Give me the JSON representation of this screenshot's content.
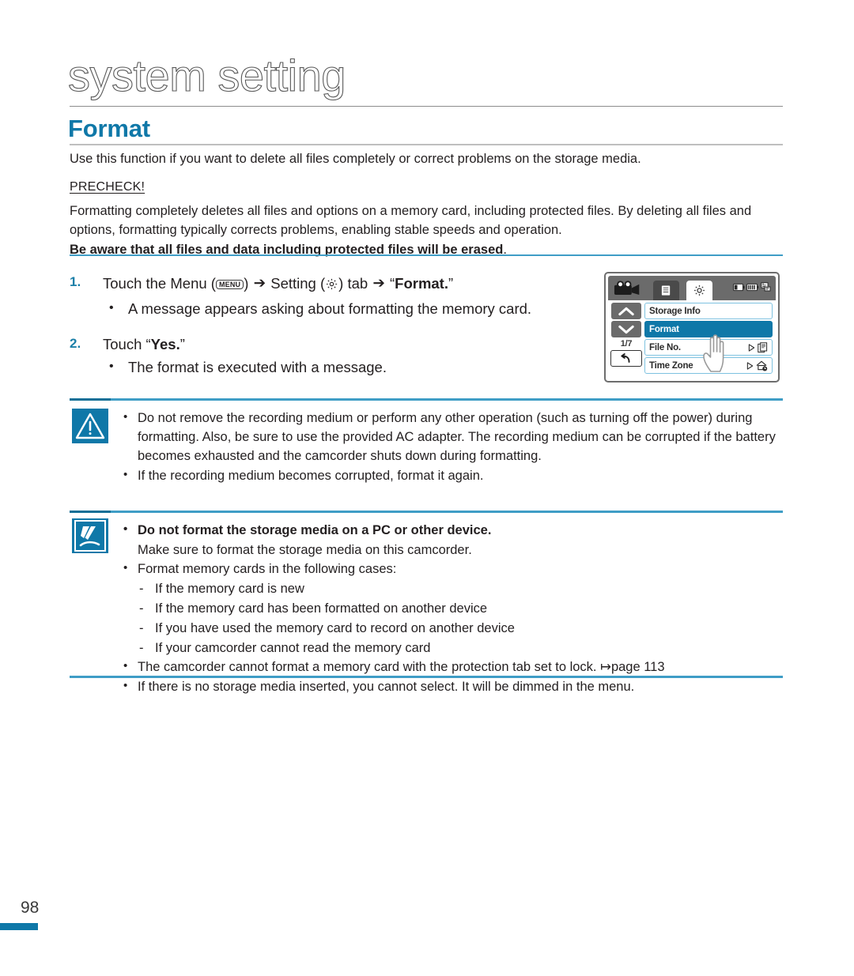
{
  "page": {
    "chapter_title": "system setting",
    "section_title": "Format",
    "page_number": "98"
  },
  "intro": {
    "text": "Use this function if you want to delete all files completely or correct problems on the storage media."
  },
  "precheck": {
    "label": "PRECHECK!",
    "paragraph": "Formatting completely deletes all files and options on a memory card, including protected files. By deleting all files and options, formatting typically corrects problems, enabling stable speeds and operation.",
    "bold_line": "Be aware that all files and data including protected files will be erased",
    "bold_line_tail": "."
  },
  "steps": [
    {
      "number": "1.",
      "text_before_menu": "Touch the Menu (",
      "menu_key_label": "MENU",
      "text_after_menu": ") ",
      "arrow": "➔",
      "setting_word": " Setting (",
      "setting_icon": "gear-icon",
      "tab_word": ") tab ",
      "target_quote_open": " “",
      "target": "Format.",
      "target_quote_close": "”",
      "bullets": [
        "A message appears asking about formatting the memory card."
      ]
    },
    {
      "number": "2.",
      "text": "Touch “",
      "target": "Yes.",
      "text_close": "”",
      "bullets": [
        "The format is executed with a message."
      ]
    }
  ],
  "lcd": {
    "camcorder_icon": "camcorder-icon",
    "tabs": [
      {
        "icon": "list-icon",
        "active": false
      },
      {
        "icon": "gear-icon",
        "active": true
      }
    ],
    "status_icons": [
      "battery-icon",
      "battery-full-icon",
      "storage-icon"
    ],
    "nav": {
      "up": "▲",
      "down": "▼",
      "page_indicator": "1/7",
      "back": "↩"
    },
    "items": [
      {
        "label": "Storage Info",
        "selected": false,
        "has_submenu": false,
        "submenu_icon": ""
      },
      {
        "label": "Format",
        "selected": true,
        "has_submenu": false,
        "submenu_icon": ""
      },
      {
        "label": "File No.",
        "selected": false,
        "has_submenu": true,
        "submenu_icon": "file-icon"
      },
      {
        "label": "Time Zone",
        "selected": false,
        "has_submenu": true,
        "submenu_icon": "home-clock-icon"
      }
    ],
    "pointer": "hand-pointer-icon"
  },
  "caution_box": {
    "icon": "caution-triangle-icon",
    "bullets": [
      "Do not remove the recording medium or perform any other operation (such as turning off the power) during formatting. Also, be sure to use the provided AC adapter. The recording medium can be corrupted if the battery becomes exhausted and the camcorder shuts down during formatting.",
      "If the recording medium becomes corrupted, format it again."
    ]
  },
  "note_box": {
    "icon": "note-pen-icon",
    "bold_bullet": "Do not format the storage media on a PC or other device.",
    "bold_bullet_sub": "Make sure to format the storage media on this camcorder.",
    "cases_intro": "Format memory cards in the following cases:",
    "cases": [
      "If the memory card is new",
      "If the memory card has been formatted on another device",
      "If you have used the memory card to record on another device",
      "If your camcorder cannot read the memory card"
    ],
    "bullet_protection": "The camcorder cannot format a memory card with the protection tab set to lock.",
    "page_ref_arrow": "↦",
    "page_ref": "page 113",
    "bullet_no_media": "If there is no storage media inserted, you cannot select. It will be dimmed in the menu."
  },
  "colors": {
    "accent_teal": "#0f78a8",
    "rule_blue": "#3f9dc6",
    "text": "#231f20"
  }
}
